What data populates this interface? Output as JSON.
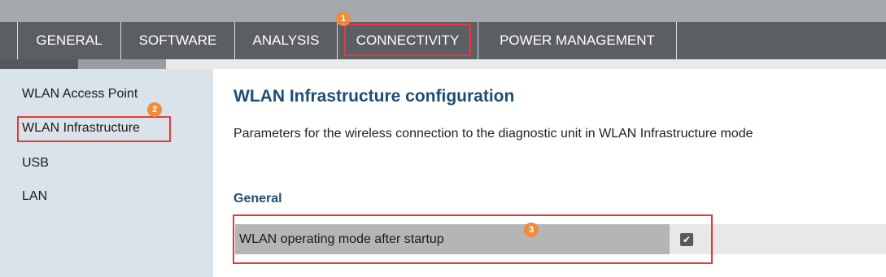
{
  "tabs": [
    {
      "label": "GENERAL"
    },
    {
      "label": "SOFTWARE"
    },
    {
      "label": "ANALYSIS"
    },
    {
      "label": "CONNECTIVITY"
    },
    {
      "label": "POWER MANAGEMENT"
    }
  ],
  "sidebar": {
    "items": [
      {
        "label": "WLAN Access Point"
      },
      {
        "label": "WLAN Infrastructure"
      },
      {
        "label": "USB"
      },
      {
        "label": "LAN"
      }
    ]
  },
  "main": {
    "title": "WLAN Infrastructure configuration",
    "description": "Parameters for the wireless connection to the diagnostic unit in WLAN Infrastructure mode",
    "section_title": "General",
    "parameter": {
      "label": "WLAN operating mode after startup",
      "checked": true,
      "check_glyph": "✔"
    }
  },
  "annotations": {
    "badge_1": "1",
    "badge_2": "2",
    "badge_3": "3"
  },
  "colors": {
    "tab_bar": "#5b5f63",
    "sidebar_bg": "#d9e3e9",
    "heading": "#1f4e74",
    "callout": "#e23b3b",
    "badge": "#ef8b3a"
  },
  "icons": {
    "checkbox": "checkmark-icon"
  }
}
